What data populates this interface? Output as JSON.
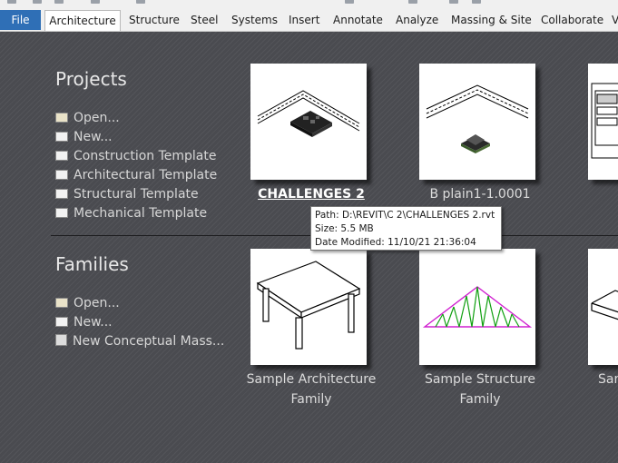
{
  "ribbon": {
    "tabs": [
      {
        "label": "File",
        "active": false,
        "file": true
      },
      {
        "label": "Architecture",
        "active": true
      },
      {
        "label": "Structure"
      },
      {
        "label": "Steel"
      },
      {
        "label": "Systems"
      },
      {
        "label": "Insert"
      },
      {
        "label": "Annotate"
      },
      {
        "label": "Analyze"
      },
      {
        "label": "Massing & Site"
      },
      {
        "label": "Collaborate"
      },
      {
        "label": "V"
      }
    ]
  },
  "projects": {
    "title": "Projects",
    "links": [
      {
        "label": "Open...",
        "icon": "folder-open-icon"
      },
      {
        "label": "New...",
        "icon": "new-file-icon"
      },
      {
        "label": "Construction Template",
        "icon": "template-file-icon"
      },
      {
        "label": "Architectural Template",
        "icon": "template-file-icon"
      },
      {
        "label": "Structural Template",
        "icon": "template-file-icon"
      },
      {
        "label": "Mechanical Template",
        "icon": "template-file-icon"
      }
    ],
    "recent": [
      {
        "name": "CHALLENGES 2",
        "highlighted": true
      },
      {
        "name": "B plain1-1.0001",
        "highlighted": false
      }
    ]
  },
  "families": {
    "title": "Families",
    "links": [
      {
        "label": "Open...",
        "icon": "folder-open-icon"
      },
      {
        "label": "New...",
        "icon": "new-file-icon"
      },
      {
        "label": "New Conceptual Mass...",
        "icon": "mass-cube-icon"
      }
    ],
    "recent": [
      {
        "name_line1": "Sample Architecture",
        "name_line2": "Family"
      },
      {
        "name_line1": "Sample Structure",
        "name_line2": "Family"
      },
      {
        "name_line1": "Sar",
        "name_line2": ""
      }
    ]
  },
  "tooltip": {
    "path": "Path: D:\\REVIT\\C 2\\CHALLENGES 2.rvt",
    "size": "Size: 5.5 MB",
    "modified": "Date Modified: 11/10/21 21:36:04"
  }
}
